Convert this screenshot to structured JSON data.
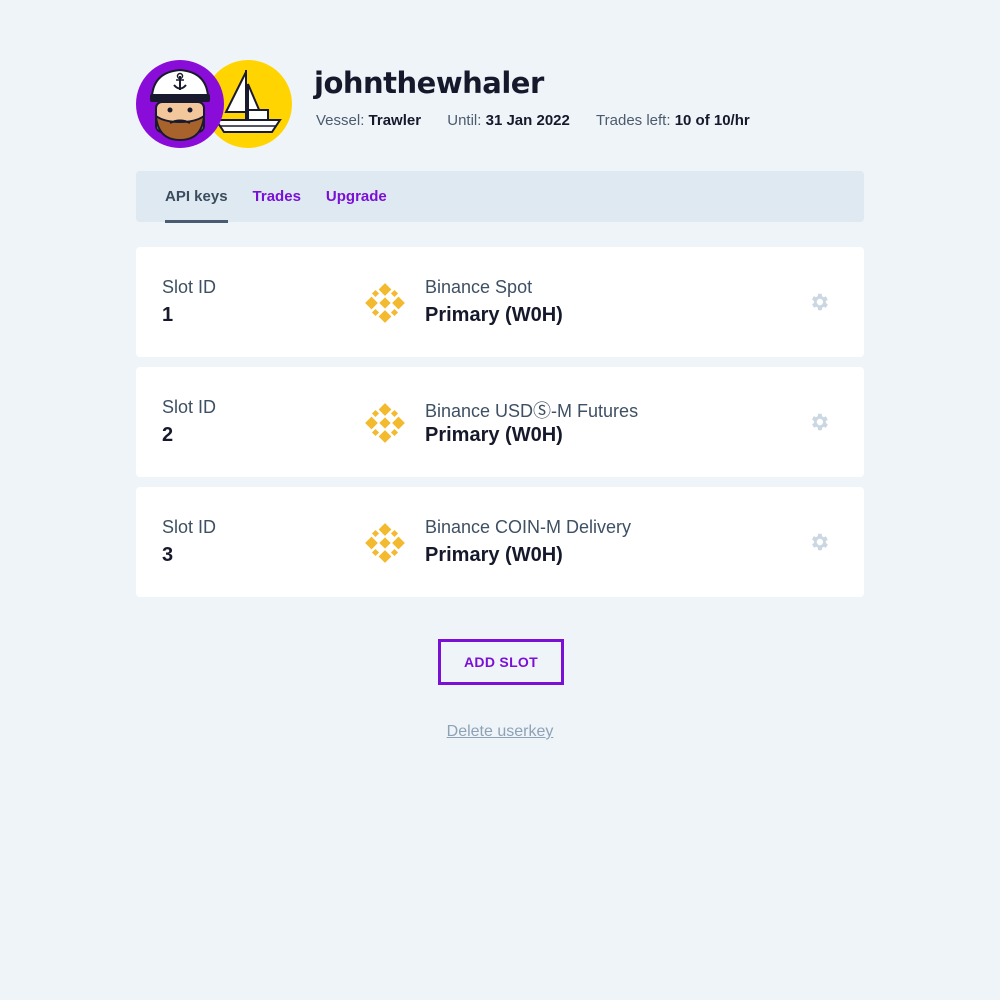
{
  "profile": {
    "username": "johnthewhaler",
    "avatar_icon": "captain-avatar-icon",
    "vessel_icon": "sailboat-icon",
    "vessel_label": "Vessel:",
    "vessel_value": "Trawler",
    "until_label": "Until:",
    "until_value": "31 Jan 2022",
    "trades_label": "Trades left:",
    "trades_value": "10 of 10/hr"
  },
  "tabs": [
    {
      "label": "API keys",
      "active": true
    },
    {
      "label": "Trades",
      "active": false
    },
    {
      "label": "Upgrade",
      "active": false
    }
  ],
  "slots": [
    {
      "id_label": "Slot ID",
      "id": "1",
      "exchange": "Binance Spot",
      "key": "Primary (W0H)",
      "logo": "binance-logo-icon",
      "action_icon": "gear-icon"
    },
    {
      "id_label": "Slot ID",
      "id": "2",
      "exchange": "Binance USDⓈ-M Futures",
      "key": "Primary (W0H)",
      "logo": "binance-logo-icon",
      "action_icon": "gear-icon"
    },
    {
      "id_label": "Slot ID",
      "id": "3",
      "exchange": "Binance COIN-M Delivery",
      "key": "Primary (W0H)",
      "logo": "binance-logo-icon",
      "action_icon": "gear-icon"
    }
  ],
  "actions": {
    "add_slot_label": "ADD SLOT",
    "delete_label": "Delete userkey"
  },
  "colors": {
    "accent": "#7a10d6",
    "binance_yellow": "#f3ba2f",
    "background": "#eff4f9",
    "avatar_purple": "#8a0cd8",
    "avatar_yellow": "#ffd400"
  }
}
